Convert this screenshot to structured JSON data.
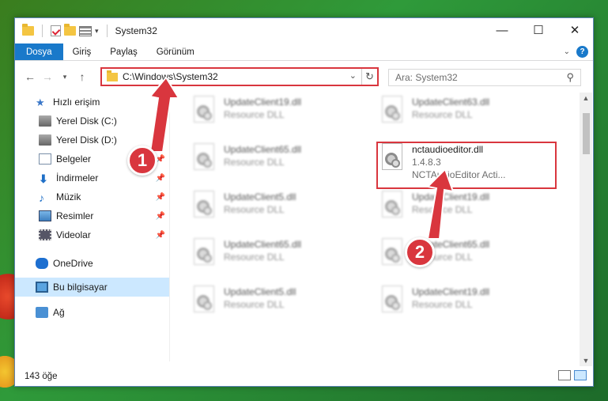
{
  "window": {
    "title": "System32"
  },
  "controls": {
    "minimize": "—",
    "maximize": "☐",
    "close": "✕"
  },
  "ribbon": {
    "tabs": [
      "Dosya",
      "Giriş",
      "Paylaş",
      "Görünüm"
    ],
    "help": "?"
  },
  "address": {
    "path": "C:\\Windows\\System32",
    "search_placeholder": "Ara: System32"
  },
  "sidebar": {
    "quick_access": "Hızlı erişim",
    "items": [
      {
        "label": "Yerel Disk (C:)",
        "icon": "drive-icon",
        "pinned": true
      },
      {
        "label": "Yerel Disk (D:)",
        "icon": "drive-icon",
        "pinned": true
      },
      {
        "label": "Belgeler",
        "icon": "documents-icon",
        "pinned": true
      },
      {
        "label": "İndirmeler",
        "icon": "downloads-icon",
        "pinned": true
      },
      {
        "label": "Müzik",
        "icon": "music-icon",
        "pinned": true
      },
      {
        "label": "Resimler",
        "icon": "pictures-icon",
        "pinned": true
      },
      {
        "label": "Videolar",
        "icon": "videos-icon",
        "pinned": true
      }
    ],
    "onedrive": "OneDrive",
    "this_pc": "Bu bilgisayar",
    "network": "Ağ"
  },
  "files": {
    "left": [
      {
        "name": "UpdateClient19.dll",
        "desc": "Resource DLL"
      },
      {
        "name": "UpdateClient65.dll",
        "desc": "Resource DLL"
      },
      {
        "name": "UpdateClient5.dll",
        "desc": "Resource DLL"
      },
      {
        "name": "UpdateClient65.dll",
        "desc": "Resource DLL"
      },
      {
        "name": "UpdateClient5.dll",
        "desc": "Resource DLL"
      }
    ],
    "right": [
      {
        "name": "UpdateClient63.dll",
        "desc": "Resource DLL"
      },
      {
        "name": "UpdateClient19.dll",
        "desc": "Resource DLL"
      },
      {
        "name": "UpdateClient65.dll",
        "desc": "Resource DLL"
      },
      {
        "name": "UpdateClient19.dll",
        "desc": "Resource DLL"
      }
    ],
    "target": {
      "name": "nctaudioeditor.dll",
      "version": "1.4.8.3",
      "desc": "NCTAudioEditor Acti..."
    }
  },
  "status": {
    "count": "143 öğe"
  },
  "annotations": {
    "step1": "1",
    "step2": "2",
    "color": "#d9363e"
  }
}
